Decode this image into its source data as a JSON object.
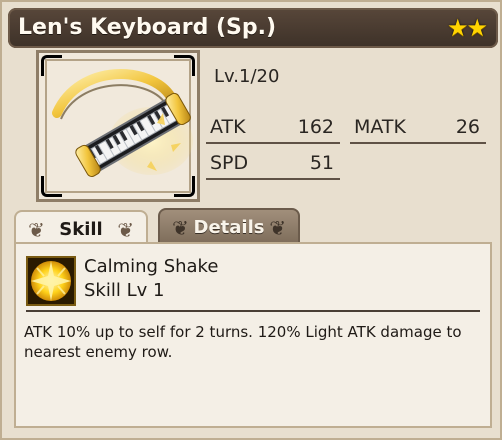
{
  "item": {
    "name": "Len's Keyboard (Sp.)",
    "stars": "★★",
    "level_text": "Lv.1/20"
  },
  "stats": {
    "atk_label": "ATK",
    "atk_value": "162",
    "matk_label": "MATK",
    "matk_value": "26",
    "spd_label": "SPD",
    "spd_value": "51"
  },
  "tabs": {
    "skill": "Skill",
    "details": "Details"
  },
  "skill": {
    "name": "Calming Shake",
    "level": "Skill Lv 1",
    "description": "ATK 10% up to self for 2 turns. 120% Light ATK damage to nearest enemy row."
  },
  "colors": {
    "titlebar": "#4a3c31",
    "panel": "#e8dfcf",
    "content_bg": "#f4efe6",
    "stars": "#ffd400",
    "details_tab": "#8f7d69"
  },
  "icons": {
    "weapon": "keyboard-weapon-icon",
    "skill": "light-burst-skill-icon"
  }
}
